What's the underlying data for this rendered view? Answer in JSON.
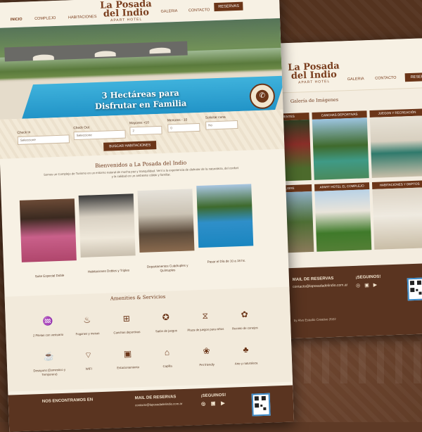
{
  "brand": {
    "line1": "La Posada",
    "line2": "del Indio",
    "sub": "APART HOTEL"
  },
  "nav": {
    "left": [
      "INICIO",
      "COMPLEJO",
      "HABITACIONES"
    ],
    "right": [
      "GALERIA",
      "CONTACTO"
    ],
    "reservas": "RESERVAS"
  },
  "hero": {
    "title": "3 Hectáreas para Disfrutar en Familia",
    "dots": "● ● ● ●",
    "badge_icon": "whatsapp-icon"
  },
  "booking": {
    "checkin_label": "Check In",
    "checkin_placeholder": "Seleccione",
    "checkout_label": "Check Out",
    "checkout_placeholder": "Seleccione",
    "mayores_label": "Mayores +10",
    "mayores_value": "2",
    "menores_label": "Menores - 10",
    "menores_value": "0",
    "cuna_label": "Solicitar cuna",
    "cuna_value": "No",
    "search_button": "BUSCAR HABITACIONES"
  },
  "welcome": {
    "title": "Bienvenidos a La Posada del Indio",
    "text": "Somos un Complejo de Turismo en un entorno natural de mucha paz y tranquilidad. Vení a la experiencia de disfrutar de la naturaleza, del confort y la calidad en un ambiente cálido y familiar."
  },
  "rooms": [
    {
      "label": "Suite Especial Doble"
    },
    {
      "label": "Habitaciones Dobles y Triples"
    },
    {
      "label": "Departamentos Cuádruples y Quíntuples"
    },
    {
      "label": "Pasar el Día de 10 a 18 hs."
    }
  ],
  "amenities": {
    "title": "Amenities & Servicios",
    "items": [
      {
        "label": "2 Piletas con vestuario",
        "icon": "pool-icon",
        "glyph": "♒"
      },
      {
        "label": "Fogones y mesas",
        "icon": "campfire-icon",
        "glyph": "♨"
      },
      {
        "label": "Canchas deportivas",
        "icon": "field-icon",
        "glyph": "⊞"
      },
      {
        "label": "Salón de juegos",
        "icon": "games-icon",
        "glyph": "✪"
      },
      {
        "label": "Plaza de juegos para niños",
        "icon": "playground-icon",
        "glyph": "⧖"
      },
      {
        "label": "Recinto de conejos",
        "icon": "rabbit-icon",
        "glyph": "✿"
      },
      {
        "label": "Desayuno (Domestico y Temporero)",
        "icon": "breakfast-icon",
        "glyph": "☕"
      },
      {
        "label": "WIFI",
        "icon": "wifi-icon",
        "glyph": "⌔"
      },
      {
        "label": "Estacionamiento",
        "icon": "parking-icon",
        "glyph": "▣"
      },
      {
        "label": "Capilla",
        "icon": "chapel-icon",
        "glyph": "⌂"
      },
      {
        "label": "Pet friendly",
        "icon": "pet-icon",
        "glyph": "❀"
      },
      {
        "label": "Arte y naturaleza",
        "icon": "art-icon",
        "glyph": "♣"
      }
    ]
  },
  "footer": {
    "find_title": "NOS ENCONTRAMOS EN",
    "find_text": "",
    "mail_title": "MAIL DE RESERVAS",
    "mail_text": "contacto@laposadadelindio.com.ar",
    "social_title": "¡SEGUINOS!",
    "social": [
      "instagram-icon",
      "facebook-icon",
      "youtube-icon"
    ]
  },
  "gallery": {
    "title": "Galería de Imágenes",
    "items": [
      {
        "label": "HOS Y PUENTES"
      },
      {
        "label": "CANCHAS DEPORTIVAS"
      },
      {
        "label": "JUEGOS Y RECREACIÓN"
      },
      {
        "label": "Y AIRE LIBRE"
      },
      {
        "label": "APART HOTEL EL COMPLEJO"
      },
      {
        "label": "HABITACIONES Y DEPTOS"
      }
    ],
    "footer_mail_title": "MAIL DE RESERVAS",
    "footer_mail_text": "contacto@laposadadelindio.com.ar",
    "footer_social_title": "¡SEGUINOS!",
    "credit": "by Alvo Estudio Creativo 2022"
  },
  "colors": {
    "brand_brown": "#6b3518",
    "cream": "#f7f1e4",
    "footer": "#5a3420",
    "pool_blue": "#1a8cc2"
  }
}
